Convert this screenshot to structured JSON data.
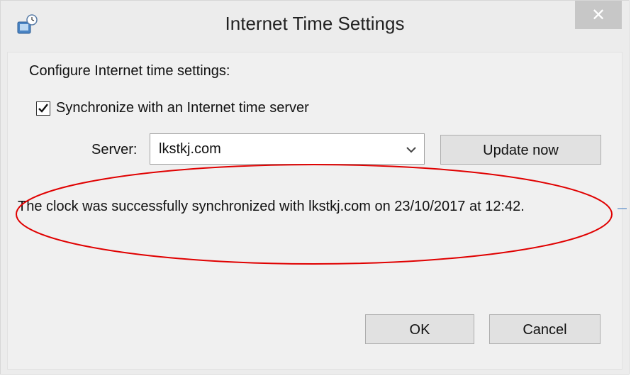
{
  "window": {
    "title": "Internet Time Settings",
    "close_symbol": "✕",
    "icon": "clock-network-icon"
  },
  "content": {
    "configure_label": "Configure Internet time settings:",
    "sync_checkbox": {
      "label": "Synchronize with an Internet time server",
      "checked": true
    },
    "server": {
      "label": "Server:",
      "value": "lkstkj.com"
    },
    "update_button_label": "Update now",
    "status_message": "The clock was successfully synchronized with lkstkj.com on 23/10/2017 at 12:42."
  },
  "footer": {
    "ok_label": "OK",
    "cancel_label": "Cancel"
  },
  "colors": {
    "annotation_ellipse": "#e00000",
    "close_button": "#c7c7c7"
  }
}
